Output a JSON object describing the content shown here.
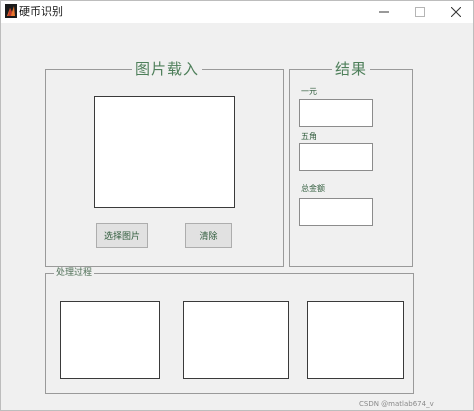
{
  "window": {
    "title": "硬币识别",
    "icon": "matlab-icon",
    "controls": {
      "minimize": "minimize-icon",
      "maximize": "maximize-icon",
      "close": "close-icon"
    }
  },
  "load_panel": {
    "title": "图片载入",
    "select_button": "选择图片",
    "clear_button": "清除"
  },
  "result_panel": {
    "title": "结果",
    "fields": [
      {
        "label": "一元",
        "value": ""
      },
      {
        "label": "五角",
        "value": ""
      },
      {
        "label": "总金额",
        "value": ""
      }
    ]
  },
  "process_panel": {
    "title": "处理过程"
  },
  "watermark": "CSDN @matlab674_v",
  "colors": {
    "legend": "#4e7f5a",
    "background": "#f0f0f0"
  }
}
